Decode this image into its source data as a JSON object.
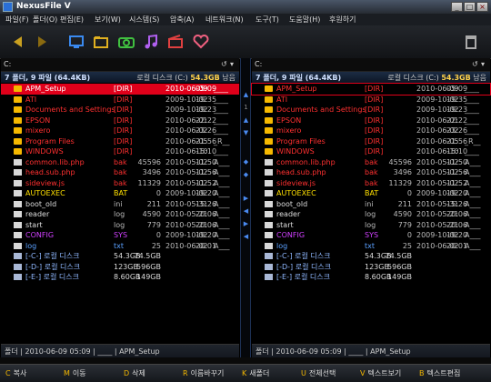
{
  "window": {
    "title": "NexusFile V",
    "min": "_",
    "max": "□",
    "close": "×"
  },
  "menu": [
    "파일(F)",
    "폴더(O)",
    "편집(E)",
    "보기(W)",
    "시스템(S)",
    "압축(A)",
    "네트워크(N)",
    "도구(T)",
    "도움말(H)",
    "후원하기"
  ],
  "panes": [
    {
      "path": "C:",
      "summary": "7 폴더, 9 파일 (64.4KB)",
      "disk_label": "로컬 디스크 (C:)",
      "disk_free": "54.3GB",
      "free_suffix": "남음",
      "status": "폴더 | 2010-06-09 05:09 | ____ | APM_Setup",
      "rows": [
        {
          "icon": "folder",
          "name": "APM_Setup",
          "ext": "[DIR]",
          "size": "",
          "date": "2010-06-09",
          "time": "05:09",
          "attr": "____",
          "color": "#ffffff",
          "sel": true
        },
        {
          "icon": "folder",
          "name": "ATI",
          "ext": "[DIR]",
          "size": "",
          "date": "2009-10-02",
          "time": "19:35",
          "attr": "____",
          "color": "#ff3030"
        },
        {
          "icon": "folder",
          "name": "Documents and Settings",
          "ext": "[DIR]",
          "size": "",
          "date": "2009-10-02",
          "time": "19:23",
          "attr": "____",
          "color": "#ff3030"
        },
        {
          "icon": "folder",
          "name": "EPSON",
          "ext": "[DIR]",
          "size": "",
          "date": "2010-06-01",
          "time": "22:22",
          "attr": "____",
          "color": "#ff3030"
        },
        {
          "icon": "folder",
          "name": "mixero",
          "ext": "[DIR]",
          "size": "",
          "date": "2010-06-02",
          "time": "23:26",
          "attr": "____",
          "color": "#ff3030"
        },
        {
          "icon": "folder",
          "name": "Program Files",
          "ext": "[DIR]",
          "size": "",
          "date": "2010-06-05",
          "time": "21:56",
          "attr": "_R__",
          "color": "#ff3030"
        },
        {
          "icon": "folder",
          "name": "WINDOWS",
          "ext": "[DIR]",
          "size": "",
          "date": "2010-06-10",
          "time": "15:10",
          "attr": "____",
          "color": "#ff3030"
        },
        {
          "icon": "doc",
          "name": "common.lib.php",
          "ext": "bak",
          "size": "45596",
          "date": "2010-05-02",
          "time": "11:50",
          "attr": "A___",
          "color": "#ff3030"
        },
        {
          "icon": "doc",
          "name": "head.sub.php",
          "ext": "bak",
          "size": "3496",
          "date": "2010-05-02",
          "time": "11:56",
          "attr": "A___",
          "color": "#ff3030"
        },
        {
          "icon": "doc",
          "name": "sideview.js",
          "ext": "bak",
          "size": "11329",
          "date": "2010-05-02",
          "time": "11:52",
          "attr": "A___",
          "color": "#ff3030"
        },
        {
          "icon": "doc",
          "name": "AUTOEXEC",
          "ext": "BAT",
          "size": "0",
          "date": "2009-10-02",
          "time": "19:20",
          "attr": "A___",
          "color": "#ffe000"
        },
        {
          "icon": "doc",
          "name": "boot_old",
          "ext": "ini",
          "size": "211",
          "date": "2010-05-31",
          "time": "15:26",
          "attr": "A___",
          "color": "#dddddd"
        },
        {
          "icon": "doc",
          "name": "reader",
          "ext": "log",
          "size": "4590",
          "date": "2010-05-21",
          "time": "20:06",
          "attr": "A___",
          "color": "#dddddd"
        },
        {
          "icon": "doc",
          "name": "start",
          "ext": "log",
          "size": "779",
          "date": "2010-05-21",
          "time": "20:06",
          "attr": "A___",
          "color": "#dddddd"
        },
        {
          "icon": "doc",
          "name": "CONFIG",
          "ext": "SYS",
          "size": "0",
          "date": "2009-10-02",
          "time": "19:20",
          "attr": "A___",
          "color": "#d040ff"
        },
        {
          "icon": "doc",
          "name": "log",
          "ext": "txt",
          "size": "25",
          "date": "2010-06-02",
          "time": "20:01",
          "attr": "A___",
          "color": "#5aa0ff"
        },
        {
          "icon": "drive",
          "name": "[-C-] 로컬 디스크",
          "ext": "54.3GB",
          "size": "74.5GB",
          "date": "",
          "time": "",
          "attr": "",
          "color": "#8fb8ff"
        },
        {
          "icon": "drive",
          "name": "[-D-] 로컬 디스크",
          "ext": "123GB",
          "size": "596GB",
          "date": "",
          "time": "",
          "attr": "",
          "color": "#8fb8ff"
        },
        {
          "icon": "drive",
          "name": "[-E-] 로컬 디스크",
          "ext": "8.60GB",
          "size": "149GB",
          "date": "",
          "time": "",
          "attr": "",
          "color": "#8fb8ff"
        }
      ]
    },
    {
      "path": "C:",
      "summary": "7 폴더, 9 파일 (64.4KB)",
      "disk_label": "로컬 디스크 (C:)",
      "disk_free": "54.3GB",
      "free_suffix": "남음",
      "status": "폴더 | 2010-06-09 05:09 | ____ | APM_Setup",
      "rows": [
        {
          "icon": "folder",
          "name": "APM_Setup",
          "ext": "[DIR]",
          "size": "",
          "date": "2010-06-09",
          "time": "05:09",
          "attr": "____",
          "color": "#ff3030",
          "outline": true
        },
        {
          "icon": "folder",
          "name": "ATI",
          "ext": "[DIR]",
          "size": "",
          "date": "2009-10-02",
          "time": "19:35",
          "attr": "____",
          "color": "#ff3030"
        },
        {
          "icon": "folder",
          "name": "Documents and Settings",
          "ext": "[DIR]",
          "size": "",
          "date": "2009-10-02",
          "time": "19:23",
          "attr": "____",
          "color": "#ff3030"
        },
        {
          "icon": "folder",
          "name": "EPSON",
          "ext": "[DIR]",
          "size": "",
          "date": "2010-06-01",
          "time": "22:22",
          "attr": "____",
          "color": "#ff3030"
        },
        {
          "icon": "folder",
          "name": "mixero",
          "ext": "[DIR]",
          "size": "",
          "date": "2010-06-02",
          "time": "23:26",
          "attr": "____",
          "color": "#ff3030"
        },
        {
          "icon": "folder",
          "name": "Program Files",
          "ext": "[DIR]",
          "size": "",
          "date": "2010-06-05",
          "time": "21:56",
          "attr": "_R__",
          "color": "#ff3030"
        },
        {
          "icon": "folder",
          "name": "WINDOWS",
          "ext": "[DIR]",
          "size": "",
          "date": "2010-06-10",
          "time": "15:10",
          "attr": "____",
          "color": "#ff3030"
        },
        {
          "icon": "doc",
          "name": "common.lib.php",
          "ext": "bak",
          "size": "45596",
          "date": "2010-05-02",
          "time": "11:50",
          "attr": "A___",
          "color": "#ff3030"
        },
        {
          "icon": "doc",
          "name": "head.sub.php",
          "ext": "bak",
          "size": "3496",
          "date": "2010-05-02",
          "time": "11:56",
          "attr": "A___",
          "color": "#ff3030"
        },
        {
          "icon": "doc",
          "name": "sideview.js",
          "ext": "bak",
          "size": "11329",
          "date": "2010-05-02",
          "time": "11:52",
          "attr": "A___",
          "color": "#ff3030"
        },
        {
          "icon": "doc",
          "name": "AUTOEXEC",
          "ext": "BAT",
          "size": "0",
          "date": "2009-10-02",
          "time": "19:20",
          "attr": "A___",
          "color": "#ffe000"
        },
        {
          "icon": "doc",
          "name": "boot_old",
          "ext": "ini",
          "size": "211",
          "date": "2010-05-31",
          "time": "15:26",
          "attr": "A___",
          "color": "#dddddd"
        },
        {
          "icon": "doc",
          "name": "reader",
          "ext": "log",
          "size": "4590",
          "date": "2010-05-21",
          "time": "20:06",
          "attr": "A___",
          "color": "#dddddd"
        },
        {
          "icon": "doc",
          "name": "start",
          "ext": "log",
          "size": "779",
          "date": "2010-05-21",
          "time": "20:06",
          "attr": "A___",
          "color": "#dddddd"
        },
        {
          "icon": "doc",
          "name": "CONFIG",
          "ext": "SYS",
          "size": "0",
          "date": "2009-10-02",
          "time": "19:20",
          "attr": "A___",
          "color": "#d040ff"
        },
        {
          "icon": "doc",
          "name": "log",
          "ext": "txt",
          "size": "25",
          "date": "2010-06-02",
          "time": "20:01",
          "attr": "A___",
          "color": "#5aa0ff"
        },
        {
          "icon": "drive",
          "name": "[-C-] 로컬 디스크",
          "ext": "54.3GB",
          "size": "74.5GB",
          "date": "",
          "time": "",
          "attr": "",
          "color": "#8fb8ff"
        },
        {
          "icon": "drive",
          "name": "[-D-] 로컬 디스크",
          "ext": "123GB",
          "size": "596GB",
          "date": "",
          "time": "",
          "attr": "",
          "color": "#8fb8ff"
        },
        {
          "icon": "drive",
          "name": "[-E-] 로컬 디스크",
          "ext": "8.60GB",
          "size": "149GB",
          "date": "",
          "time": "",
          "attr": "",
          "color": "#8fb8ff"
        }
      ]
    }
  ],
  "toolbar_icons": [
    "back-arrow-icon",
    "forward-arrow-icon",
    "monitor-icon",
    "folder-icon",
    "camera-icon",
    "music-icon",
    "video-icon",
    "heart-icon",
    "trash-icon"
  ],
  "pane_icons": {
    "refresh": "↺",
    "dropdown": "▾"
  },
  "divider_glyphs": [
    "▲",
    "1",
    "▲",
    "▼",
    "◆",
    "◆",
    "▶",
    "◀",
    "▶",
    "◀"
  ],
  "fkeys": [
    {
      "key": "C",
      "label": "복사"
    },
    {
      "key": "M",
      "label": "이동"
    },
    {
      "key": "D",
      "label": "삭제"
    },
    {
      "key": "R",
      "label": "이름바꾸기"
    },
    {
      "key": "K",
      "label": "새폴더"
    },
    {
      "key": "U",
      "label": "전체선택"
    },
    {
      "key": "V",
      "label": "텍스트보기"
    },
    {
      "key": "B",
      "label": "텍스트편집"
    }
  ]
}
